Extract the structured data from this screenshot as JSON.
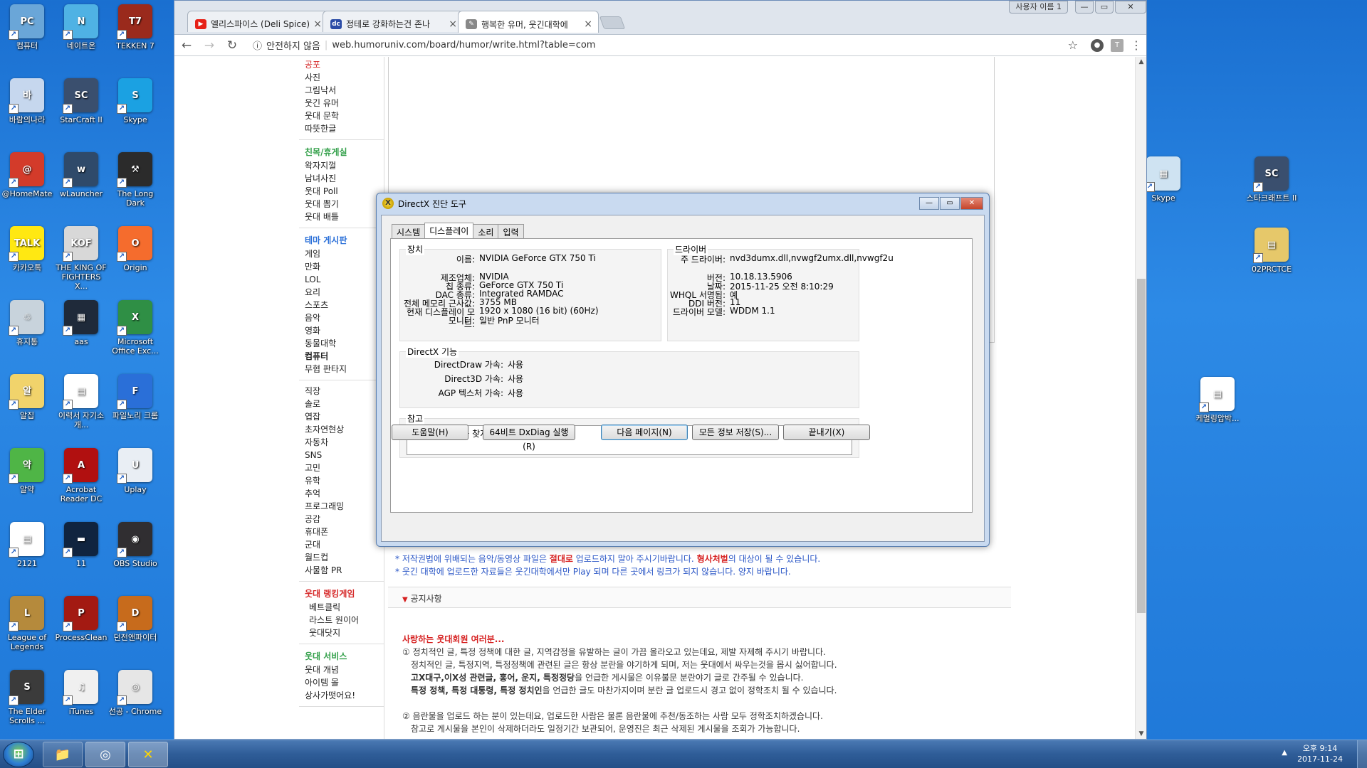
{
  "desktop_icons": [
    {
      "label": "컴퓨터",
      "color": "#6aa6d8",
      "glyph": "PC"
    },
    {
      "label": "네이트온",
      "color": "#4fb2e4",
      "glyph": "N"
    },
    {
      "label": "TEKKEN 7",
      "color": "#9a2a1c",
      "glyph": "T7"
    },
    {
      "label": "바람의나라",
      "color": "#c6d7ee",
      "glyph": "바"
    },
    {
      "label": "StarCraft II",
      "color": "#3a4f6e",
      "glyph": "SC"
    },
    {
      "label": "Skype",
      "color": "#1ba1e2",
      "glyph": "S"
    },
    {
      "label": "@HomeMate",
      "color": "#d33b2a",
      "glyph": "@"
    },
    {
      "label": "wLauncher",
      "color": "#2f4a6a",
      "glyph": "w"
    },
    {
      "label": "The Long Dark",
      "color": "#2b2b2b",
      "glyph": "⚒"
    },
    {
      "label": "카카오톡",
      "color": "#ffe812",
      "glyph": "TALK"
    },
    {
      "label": "THE KING OF FIGHTERS X...",
      "color": "#d8d8d8",
      "glyph": "KOF"
    },
    {
      "label": "Origin",
      "color": "#f56c2d",
      "glyph": "O"
    },
    {
      "label": "휴지통",
      "color": "#c8d3dc",
      "glyph": "♲"
    },
    {
      "label": "aas",
      "color": "#1f2a3a",
      "glyph": "▦"
    },
    {
      "label": "Microsoft Office Exc...",
      "color": "#2f8f45",
      "glyph": "X"
    },
    {
      "label": "알집",
      "color": "#f1d36b",
      "glyph": "알"
    },
    {
      "label": "이력서 자기소개...",
      "color": "#ffffff",
      "glyph": "▤"
    },
    {
      "label": "파일노리 크롬",
      "color": "#2a6fd8",
      "glyph": "F"
    },
    {
      "label": "알약",
      "color": "#4fb546",
      "glyph": "약"
    },
    {
      "label": "Acrobat Reader DC",
      "color": "#b11010",
      "glyph": "A"
    },
    {
      "label": "Uplay",
      "color": "#e9eef4",
      "glyph": "U"
    },
    {
      "label": "2121",
      "color": "#ffffff",
      "glyph": "▤"
    },
    {
      "label": "11",
      "color": "#10243f",
      "glyph": "▬"
    },
    {
      "label": "OBS Studio",
      "color": "#302e31",
      "glyph": "◉"
    },
    {
      "label": "League of Legends",
      "color": "#b58a3c",
      "glyph": "L"
    },
    {
      "label": "ProcessClean",
      "color": "#a31a12",
      "glyph": "P"
    },
    {
      "label": "던전앤파이터",
      "color": "#c76b1c",
      "glyph": "D"
    },
    {
      "label": "The Elder Scrolls ...",
      "color": "#3b3b3b",
      "glyph": "S"
    },
    {
      "label": "iTunes",
      "color": "#f0f0f0",
      "glyph": "♫"
    },
    {
      "label": "선공 - Chrome",
      "color": "#e6e6e6",
      "glyph": "◎"
    }
  ],
  "right_icons": [
    {
      "label": "Skype",
      "color": "#cfe3f2",
      "glyph": "▦"
    },
    {
      "label": "스타크래프트 II",
      "color": "#3a4f6e",
      "glyph": "SC"
    },
    {
      "label": "02PRCTCE",
      "color": "#e6c86a",
      "glyph": "▤"
    },
    {
      "label": "케멀링압박...",
      "color": "#ffffff",
      "glyph": "▤"
    }
  ],
  "browser": {
    "user_label": "사용자 이름 1",
    "tabs": [
      {
        "title": "엘리스파이스 (Deli Spice)",
        "fav": "▶",
        "fav_color": "#e62117"
      },
      {
        "title": "정테로 강화하는건 존나",
        "fav": "dc",
        "fav_color": "#2a4ba6"
      },
      {
        "title": "행복한 유머, 웃긴대학에",
        "fav": "✎",
        "fav_color": "#888888"
      }
    ],
    "insecure_label": "안전하지 않음",
    "url": "web.humoruniv.com/board/humor/write.html?table=com"
  },
  "leftnav": {
    "sections": [
      {
        "head": "",
        "head_style": "",
        "items": [
          {
            "label": "공포",
            "style": "red"
          },
          {
            "label": "사진"
          },
          {
            "label": "그림낙서"
          },
          {
            "label": "웃긴 유머"
          },
          {
            "label": "웃대 문학"
          },
          {
            "label": "따뜻한글"
          }
        ]
      },
      {
        "head": "친목/휴게실",
        "head_style": "green",
        "items": [
          {
            "label": "왁자지껄"
          },
          {
            "label": "남녀사진"
          },
          {
            "label": "웃대 Poll"
          },
          {
            "label": "웃대 뽑기"
          },
          {
            "label": "웃대 배틀"
          }
        ]
      },
      {
        "head": "테마 게시판",
        "head_style": "blue",
        "items": [
          {
            "label": "게임"
          },
          {
            "label": "만화"
          },
          {
            "label": "LOL"
          },
          {
            "label": "요리"
          },
          {
            "label": "스포츠"
          },
          {
            "label": "음악"
          },
          {
            "label": "영화"
          },
          {
            "label": "동물대학"
          },
          {
            "label": "컴퓨터",
            "style": "bold"
          },
          {
            "label": "무협 판타지"
          }
        ]
      },
      {
        "head": "",
        "head_style": "",
        "items": [
          {
            "label": "직장"
          },
          {
            "label": "솔로"
          },
          {
            "label": "엽잡"
          },
          {
            "label": "초자연현상"
          },
          {
            "label": "자동차"
          },
          {
            "label": "SNS"
          },
          {
            "label": "고민"
          },
          {
            "label": "유학"
          },
          {
            "label": "추억"
          },
          {
            "label": "프로그래밍"
          },
          {
            "label": "공감"
          },
          {
            "label": "휴대폰"
          },
          {
            "label": "군대"
          },
          {
            "label": "월드컵"
          },
          {
            "label": "사물함 PR"
          }
        ]
      },
      {
        "head": "웃대 랭킹게임",
        "head_style": "red",
        "items": [
          {
            "label": "베트클릭",
            "style": "sub"
          },
          {
            "label": "라스트 원이어",
            "style": "sub"
          },
          {
            "label": "웃대닷지",
            "style": "sub"
          }
        ]
      },
      {
        "head": "웃대 서비스",
        "head_style": "green",
        "items": [
          {
            "label": "웃대 개념"
          },
          {
            "label": "아이템 몰"
          },
          {
            "label": "상사가떳어요!"
          }
        ]
      }
    ]
  },
  "notes": {
    "line1_a": "* 저작권법에 위배되는 음악/동영상 파일은 ",
    "line1_b": "절대로",
    "line1_c": " 업로드하지 말아 주시기바랍니다. ",
    "line1_d": "형사처벌",
    "line1_e": "의 대상이 될 수 있습니다.",
    "line2": "* 웃긴 대학에 업로드한 자료들은 웃긴대학에서만 Play 되며 다른 곳에서 링크가 되지 않습니다. 양지 바랍니다."
  },
  "notice_bar": "공지사항",
  "notice": {
    "title": "사랑하는 웃대회원 여러분...",
    "p1": "① 정치적인 글, 특정 정책에 대한 글, 지역감정을 유발하는 글이 가끔 올라오고 있는데요, 제발 자제해 주시기 바랍니다.",
    "p1b": "정치적인 글, 특정지역, 특정정책에 관련된 글은 항상 분란을 야기하게 되며, 저는 웃대에서 싸우는것을 몹시 싫어합니다.",
    "p1c_bold": "고X대구,이X성 관련글, 홍어, 운지, 특정정당",
    "p1c": "을 언급한 게시물은 이유불문 분란야기 글로 간주될 수 있습니다.",
    "p1d_bold": "특정 정책, 특정 대통령, 특정 정치인",
    "p1d": "을 언급한 글도 마찬가지이며 분란 글 업로드시 경고 없이 정학조치 될 수 있습니다.",
    "p2": "② 음란물을 업로드 하는 분이 있는데요, 업로드한 사람은 물론 음란물에 추천/동조하는 사람 모두 정학조치하겠습니다.",
    "p2b": "참고로 게시물을 본인이 삭제하더라도 일정기간 보관되어, 운영진은 최근 삭제된 게시물을 조회가 가능합니다."
  },
  "dxdiag": {
    "title": "DirectX 진단 도구",
    "tabs": [
      "시스템",
      "디스플레이",
      "소리",
      "입력"
    ],
    "device_group": "장치",
    "driver_group": "드라이버",
    "device": [
      {
        "k": "이름:",
        "v": "NVIDIA GeForce GTX 750 Ti"
      },
      {
        "k": "제조업체:",
        "v": "NVIDIA"
      },
      {
        "k": "칩 종류:",
        "v": "GeForce GTX 750 Ti"
      },
      {
        "k": "DAC 종류:",
        "v": "Integrated RAMDAC"
      },
      {
        "k": "전체 메모리 근사값:",
        "v": "3755 MB"
      },
      {
        "k": "현재 디스플레이 모드:",
        "v": "1920 x 1080 (16 bit) (60Hz)"
      },
      {
        "k": "모니터:",
        "v": "일반 PnP 모니터"
      }
    ],
    "driver": [
      {
        "k": "주 드라이버:",
        "v": "nvd3dumx.dll,nvwgf2umx.dll,nvwgf2u"
      },
      {
        "k": "버전:",
        "v": "10.18.13.5906"
      },
      {
        "k": "날짜:",
        "v": "2015-11-25 오전 8:10:29"
      },
      {
        "k": "WHQL 서명됨:",
        "v": "예"
      },
      {
        "k": "DDI 버전:",
        "v": "11"
      },
      {
        "k": "드라이버 모델:",
        "v": "WDDM 1.1"
      }
    ],
    "features_group": "DirectX 기능",
    "features": [
      {
        "k": "DirectDraw 가속:",
        "v": "사용"
      },
      {
        "k": "Direct3D 가속:",
        "v": "사용"
      },
      {
        "k": "AGP 텍스처 가속:",
        "v": "사용"
      }
    ],
    "notes_group": "참고",
    "notes_text": "아무 문제를 찾지 못했습니다.",
    "buttons": {
      "help": "도움말(H)",
      "run64": "64비트 DxDiag 실행(R)",
      "next": "다음 페이지(N)",
      "save": "모든 정보 저장(S)...",
      "exit": "끝내기(X)"
    }
  },
  "taskbar": {
    "time": "오후 9:14",
    "date": "2017-11-24"
  }
}
